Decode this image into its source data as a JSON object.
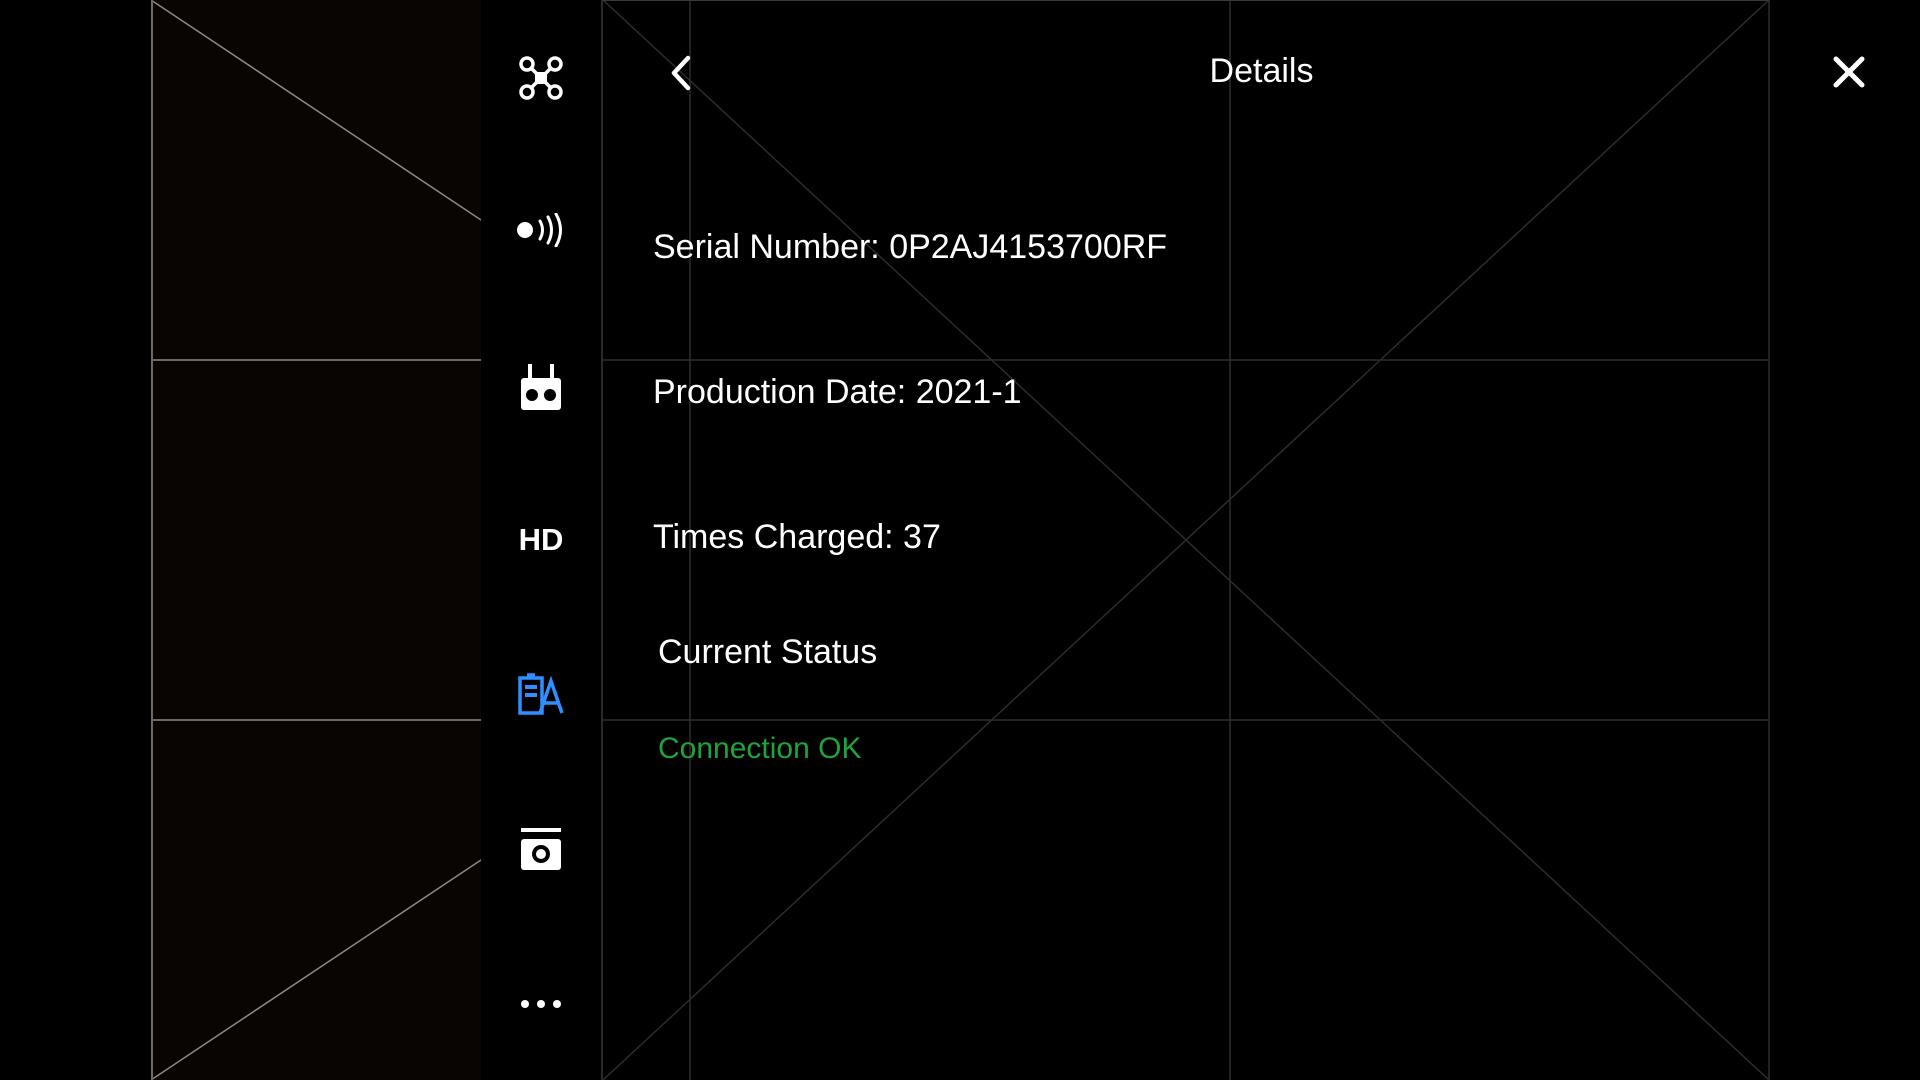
{
  "header": {
    "title": "Details"
  },
  "sidebar": {
    "items": [
      {
        "icon": "aircraft-icon"
      },
      {
        "icon": "signal-icon"
      },
      {
        "icon": "remote-controller-icon"
      },
      {
        "icon": "hd-icon",
        "label": "HD"
      },
      {
        "icon": "battery-icon",
        "active": true
      },
      {
        "icon": "camera-icon"
      },
      {
        "icon": "more-icon"
      }
    ]
  },
  "details": {
    "serial": "Serial Number: 0P2AJ4153700RF",
    "production": "Production Date: 2021-1",
    "charged": "Times Charged: 37"
  },
  "status": {
    "heading": "Current Status",
    "value": "Connection OK",
    "value_color": "#1fa33b"
  },
  "colors": {
    "accent": "#2f8fff",
    "background": "#000000"
  }
}
